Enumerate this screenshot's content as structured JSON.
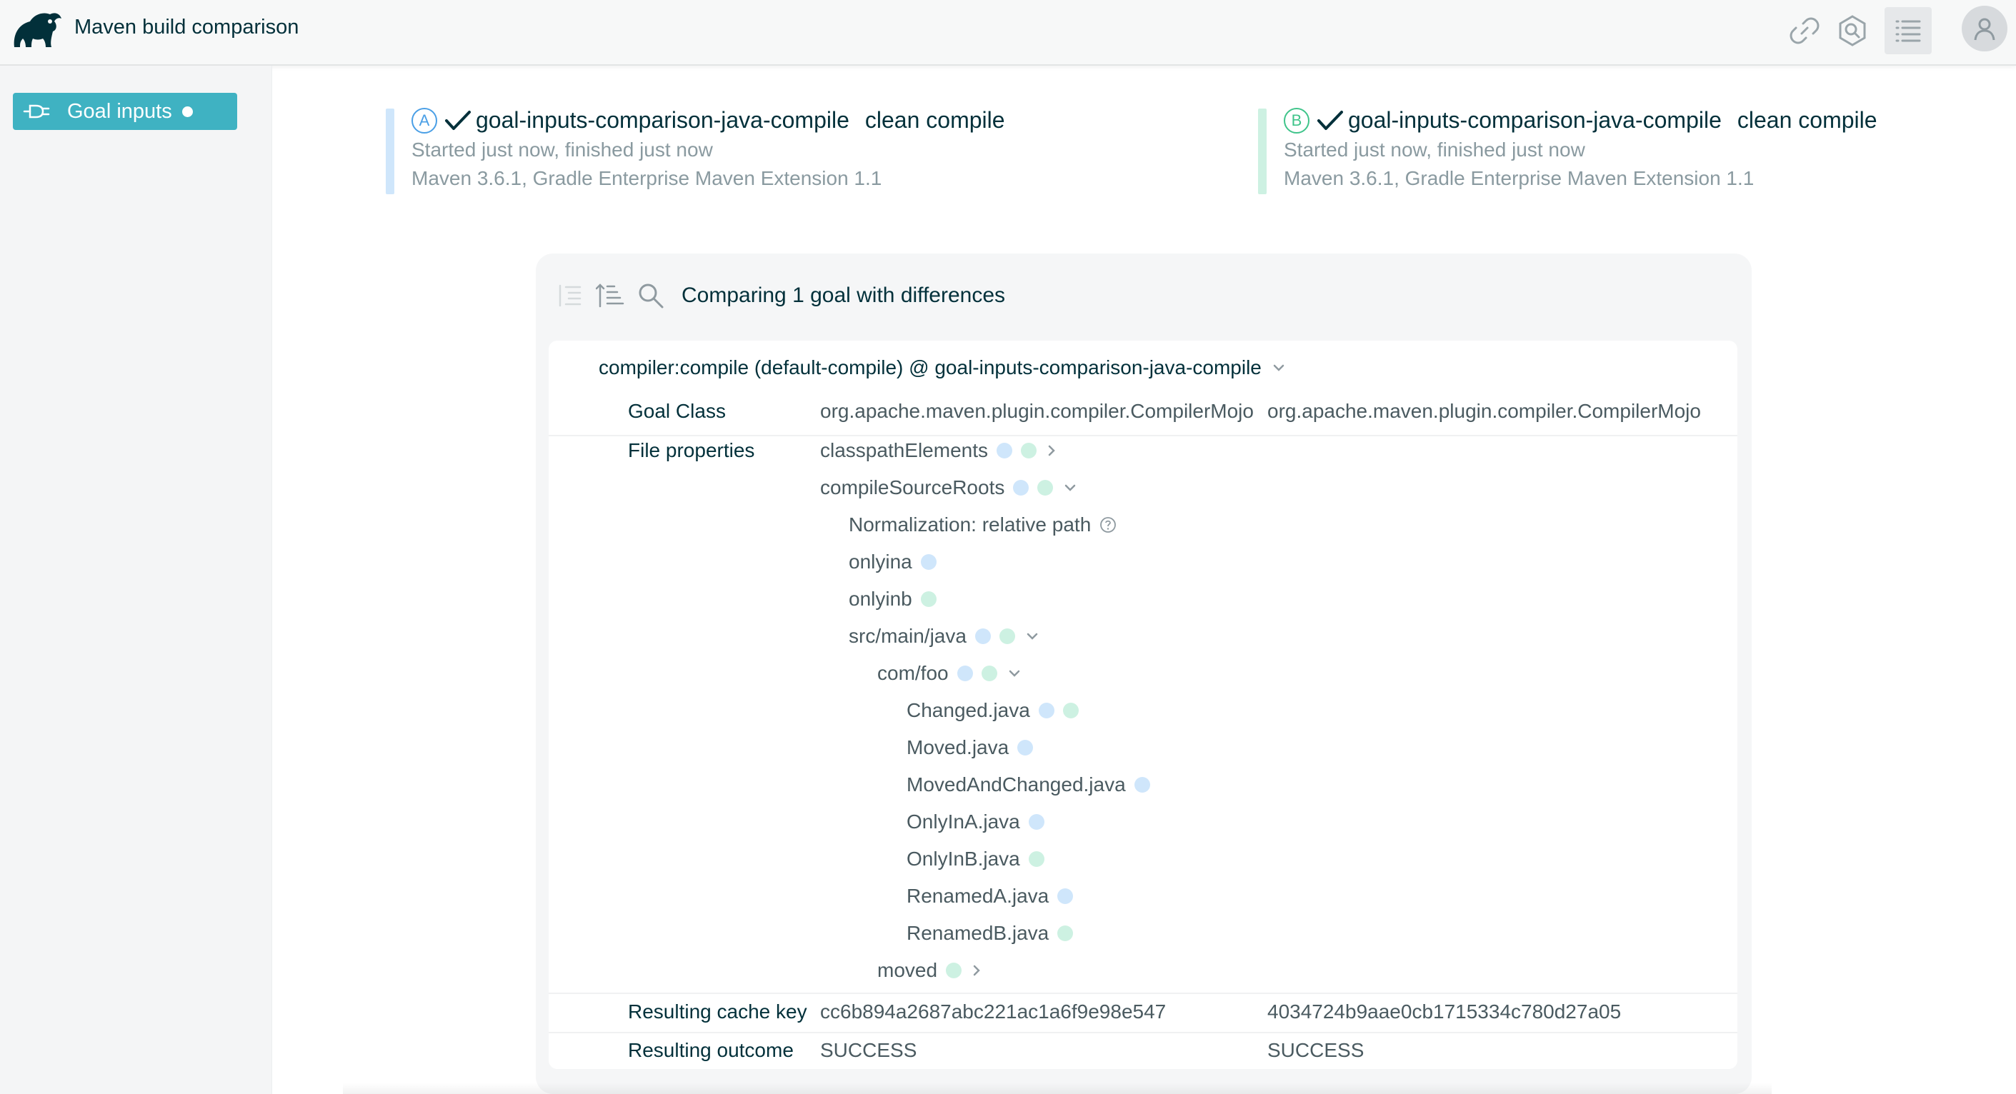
{
  "header": {
    "title": "Maven build comparison",
    "icons": [
      "link-icon",
      "scan-icon",
      "list-icon",
      "user-icon"
    ]
  },
  "sidebar": {
    "tab_label": "Goal inputs"
  },
  "builds": [
    {
      "badge": "A",
      "project": "goal-inputs-comparison-java-compile",
      "command": "clean compile",
      "timing": "Started just now, finished just now",
      "versions": "Maven 3.6.1,  Gradle Enterprise Maven Extension 1.1",
      "color": "#cfe6fb"
    },
    {
      "badge": "B",
      "project": "goal-inputs-comparison-java-compile",
      "command": "clean compile",
      "timing": "Started just now, finished just now",
      "versions": "Maven 3.6.1,  Gradle Enterprise Maven Extension 1.1",
      "color": "#cdf1e2"
    }
  ],
  "panel": {
    "summary": "Comparing 1 goal with differences",
    "goal_title": "compiler:compile (default-compile) @ goal-inputs-comparison-java-compile",
    "goal_class": {
      "label": "Goal Class",
      "a": "org.apache.maven.plugin.compiler.CompilerMojo",
      "b": "org.apache.maven.plugin.compiler.CompilerMojo"
    },
    "file_properties_label": "File properties",
    "tree": {
      "classpath": "classpathElements",
      "compile_roots": "compileSourceRoots",
      "normalization": "Normalization: relative path",
      "onlyina": "onlyina",
      "onlyinb": "onlyinb",
      "src": "src/main/java",
      "comfoo": "com/foo",
      "changed": "Changed.java",
      "moved": "Moved.java",
      "moved_changed": "MovedAndChanged.java",
      "only_a": "OnlyInA.java",
      "only_b": "OnlyInB.java",
      "renamed_a": "RenamedA.java",
      "renamed_b": "RenamedB.java",
      "moved_dir": "moved"
    },
    "cache_key": {
      "label": "Resulting cache key",
      "a": "cc6b894a2687abc221ac1a6f9e98e547",
      "b": "4034724b9aae0cb1715334c780d27a05"
    },
    "outcome": {
      "label": "Resulting outcome",
      "a": "SUCCESS",
      "b": "SUCCESS"
    }
  },
  "colors": {
    "accent": "#3fb2c2",
    "build_a": "#cfe6fb",
    "build_b": "#cdf1e2",
    "text": "#02303a"
  }
}
